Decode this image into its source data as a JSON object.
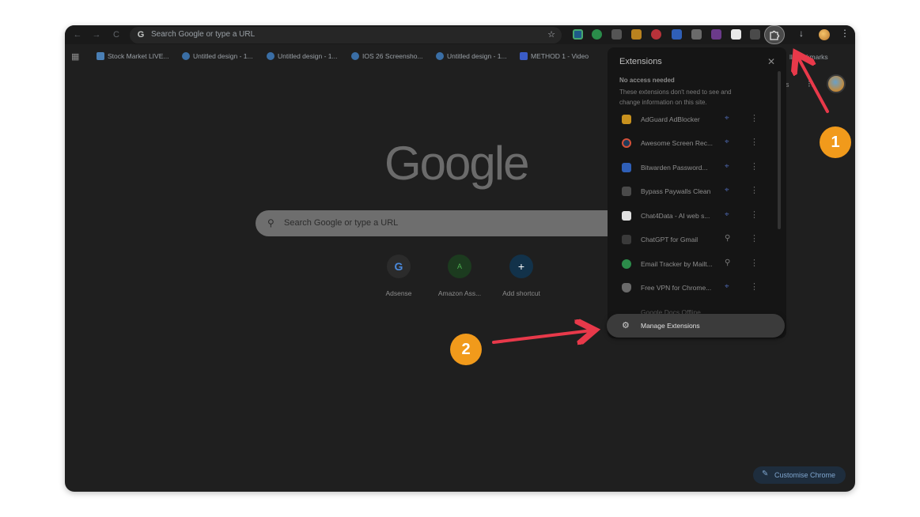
{
  "toolbar": {
    "omnibox_placeholder": "Search Google or type a URL",
    "omnibox_g": "G",
    "back": "←",
    "forward": "→",
    "reload": "C",
    "star": "☆",
    "download": "↓",
    "menu": "⋮"
  },
  "bookmarks": [
    {
      "label": "Stock Market LIVE..."
    },
    {
      "label": "Untitled design - 1..."
    },
    {
      "label": "Untitled design - 1..."
    },
    {
      "label": "IOS 26 Screensho..."
    },
    {
      "label": "Untitled design - 1..."
    },
    {
      "label": "METHOD 1 - Video"
    },
    {
      "label": "ll Bookmarks"
    }
  ],
  "newtab": {
    "logo": "Google",
    "search_placeholder": "Search Google or type a URL",
    "shortcuts": [
      {
        "label": "Adsense",
        "glyph": "G",
        "color": "#2b2b2b"
      },
      {
        "label": "Amazon Ass...",
        "glyph": "A",
        "color": "#1c3b1f"
      },
      {
        "label": "Add shortcut",
        "glyph": "+",
        "color": "#12324a"
      }
    ],
    "right_text": "es",
    "customise": "Customise Chrome"
  },
  "extensions_panel": {
    "title": "Extensions",
    "close": "✕",
    "section": "No access needed",
    "description": "These extensions don't need to see and change information on this site.",
    "items": [
      {
        "name": "AdGuard AdBlocker",
        "icon_color": "#c8911e",
        "pinned": false
      },
      {
        "name": "Awesome Screen Rec...",
        "icon_color": "#d4503a",
        "pinned": false
      },
      {
        "name": "Bitwarden Password...",
        "icon_color": "#2f5fb7",
        "pinned": false
      },
      {
        "name": "Bypass Paywalls Clean",
        "icon_color": "#5a5a5a",
        "pinned": false
      },
      {
        "name": "Chat4Data - AI web s...",
        "icon_color": "#e0e0e0",
        "pinned": false
      },
      {
        "name": "ChatGPT for Gmail",
        "icon_color": "#3a3a3a",
        "pinned": true
      },
      {
        "name": "Email Tracker by Mailt...",
        "icon_color": "#2c8c4a",
        "pinned": true
      },
      {
        "name": "Free VPN for Chrome...",
        "icon_color": "#6a6a6a",
        "pinned": false
      }
    ],
    "partial_item": "Google Docs Offline",
    "manage": "Manage Extensions"
  },
  "annotations": {
    "badge_1": "1",
    "badge_2": "2",
    "arrow_color": "#e8394a",
    "badge_color": "#f19a1b"
  }
}
